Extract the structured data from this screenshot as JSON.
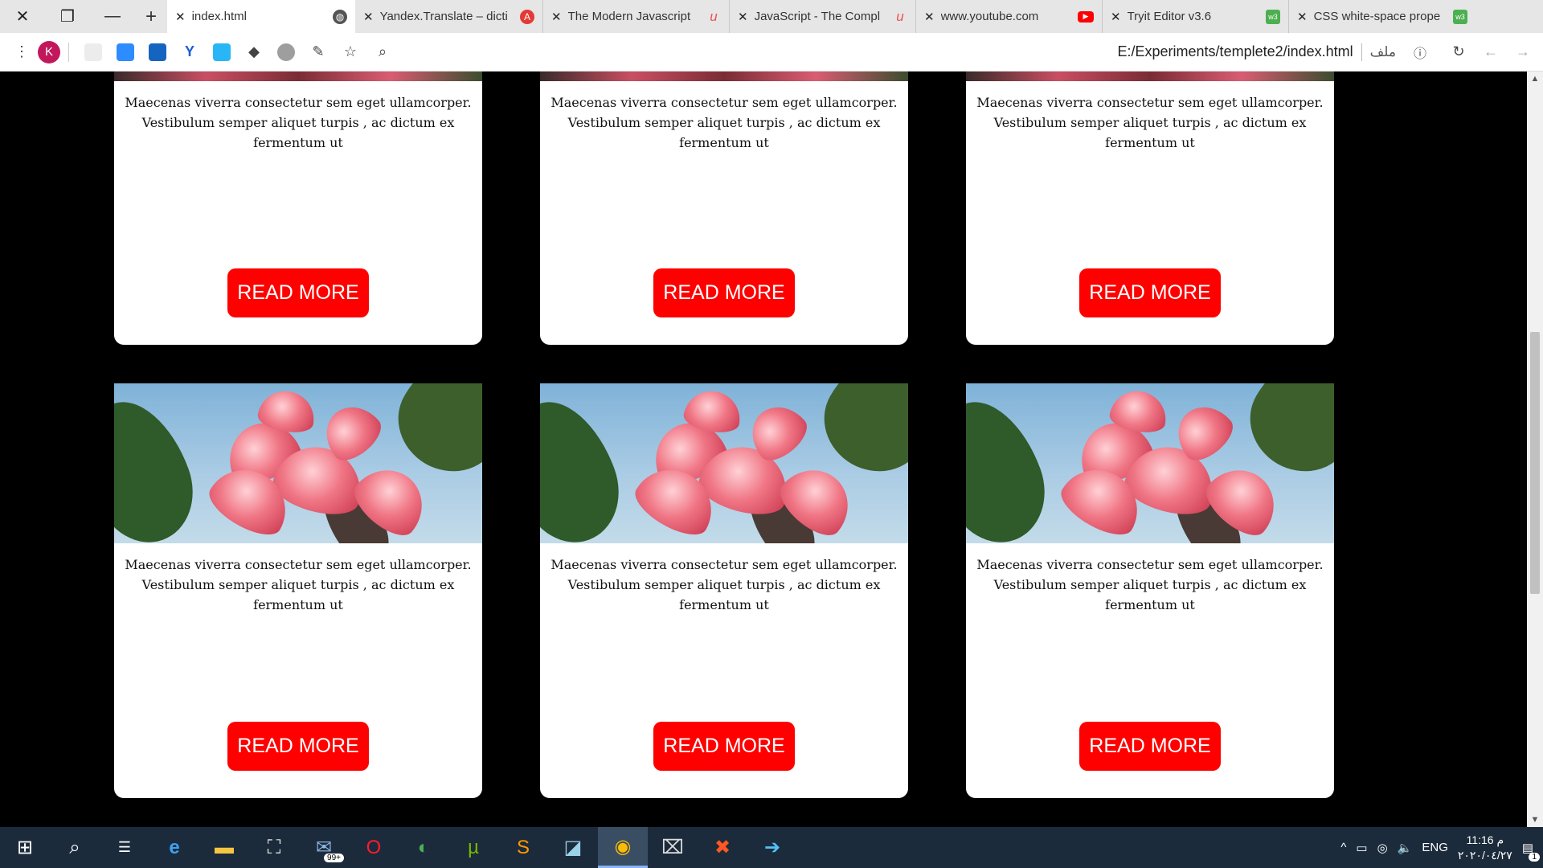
{
  "browser": {
    "tabs": [
      {
        "title": "index.html",
        "active": true,
        "icon": "globe-icon"
      },
      {
        "title": "Yandex.Translate – dicti",
        "active": false,
        "icon": "yandex-translate-icon"
      },
      {
        "title": "The Modern Javascript",
        "active": false,
        "icon": "udemy-icon"
      },
      {
        "title": "JavaScript - The Compl",
        "active": false,
        "icon": "udemy-icon"
      },
      {
        "title": "www.youtube.com",
        "active": false,
        "icon": "youtube-icon"
      },
      {
        "title": "Tryit Editor v3.6",
        "active": false,
        "icon": "w3schools-icon"
      },
      {
        "title": "CSS white-space prope",
        "active": false,
        "icon": "w3schools-icon"
      }
    ],
    "new_tab_symbol": "+",
    "profile_initial": "K",
    "url": "E:/Experiments/templete2/index.html",
    "url_scheme_label": "ملف"
  },
  "page": {
    "card_text": "Maecenas viverra consectetur sem eget ullamcorper. Vestibulum semper aliquet turpis , ac dictum ex fermentum ut",
    "button_label": "READ MORE",
    "accent_color": "#ff0000"
  },
  "taskbar": {
    "language": "ENG",
    "time": "11:16 م",
    "date": "٢٠٢٠/٠٤/٢٧",
    "mail_badge": "99+",
    "notifications": "1"
  }
}
